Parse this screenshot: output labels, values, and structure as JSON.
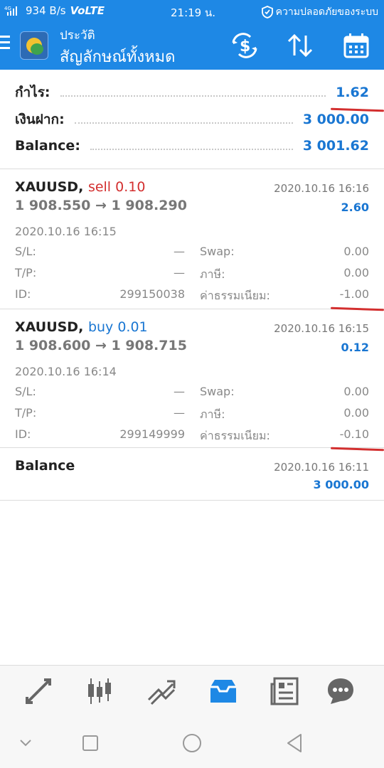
{
  "status_bar": {
    "net_badge": "4G",
    "speed": "934 B/s",
    "volte": "VoLTE",
    "time": "21:19 น.",
    "security_text": "ความปลอดภัยของระบบ"
  },
  "app_bar": {
    "title": "ประวัติ",
    "subtitle": "สัญลักษณ์ทั้งหมด",
    "icons": [
      "hamburger-icon",
      "app-logo",
      "currency-exchange-icon",
      "sort-icon",
      "calendar-icon"
    ]
  },
  "summary": {
    "profit_label": "กำไร:",
    "profit_value": "1.62",
    "deposit_label": "เงินฝาก:",
    "deposit_value": "3 000.00",
    "balance_label": "Balance:",
    "balance_value": "3 001.62"
  },
  "deals": [
    {
      "symbol": "XAUUSD,",
      "direction": "sell 0.10",
      "close_time": "2020.10.16 16:16",
      "price_open": "1 908.550",
      "arrow": "→",
      "price_close": "1 908.290",
      "profit": "2.60",
      "open_time": "2020.10.16 16:15",
      "sl_label": "S/L:",
      "sl_value": "—",
      "tp_label": "T/P:",
      "tp_value": "—",
      "id_label": "ID:",
      "id_value": "299150038",
      "swap_label": "Swap:",
      "swap_value": "0.00",
      "tax_label": "ภาษี:",
      "tax_value": "0.00",
      "fee_label": "ค่าธรรมเนียม:",
      "fee_value": "-1.00"
    },
    {
      "symbol": "XAUUSD,",
      "direction": "buy 0.01",
      "close_time": "2020.10.16 16:15",
      "price_open": "1 908.600",
      "arrow": "→",
      "price_close": "1 908.715",
      "profit": "0.12",
      "open_time": "2020.10.16 16:14",
      "sl_label": "S/L:",
      "sl_value": "—",
      "tp_label": "T/P:",
      "tp_value": "—",
      "id_label": "ID:",
      "id_value": "299149999",
      "swap_label": "Swap:",
      "swap_value": "0.00",
      "tax_label": "ภาษี:",
      "tax_value": "0.00",
      "fee_label": "ค่าธรรมเนียม:",
      "fee_value": "-0.10"
    }
  ],
  "balance_entry": {
    "label": "Balance",
    "time": "2020.10.16 16:11",
    "amount": "3 000.00"
  },
  "bottom_nav": [
    "quotes-icon",
    "chart-icon",
    "trade-icon",
    "history-icon",
    "news-icon",
    "chat-icon"
  ],
  "system_nav": [
    "chevron-down-icon",
    "recents-icon",
    "home-icon",
    "back-icon"
  ],
  "colors": {
    "accent": "#1e88e5",
    "value_blue": "#1976d2",
    "sell_red": "#d32f2f",
    "annotation_red": "#d32f2f"
  }
}
